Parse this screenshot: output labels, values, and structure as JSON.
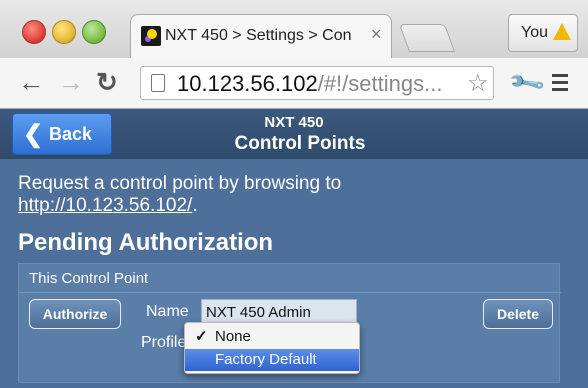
{
  "browser": {
    "tab_title": "NXT 450 > Settings > Con",
    "tab_close": "×",
    "profile_label": "You",
    "url_host": "10.123.56.102",
    "url_path": "/#!/settings..."
  },
  "header": {
    "back_label": "Back",
    "subtitle": "NXT 450",
    "title": "Control Points"
  },
  "content": {
    "request_text": "Request a control point by browsing to",
    "request_link": "http://10.123.56.102/",
    "request_suffix": ".",
    "pending_heading": "Pending Authorization",
    "panel_title": "This Control Point",
    "authorize_label": "Authorize",
    "delete_label": "Delete",
    "name_label": "Name",
    "name_value": "NXT 450 Admin",
    "profile_label": "Profile",
    "profile_options": [
      {
        "label": "None",
        "checked": true
      },
      {
        "label": "Factory Default",
        "highlighted": true
      }
    ]
  },
  "icons": {
    "check": "✓",
    "back_chevron": "❮"
  }
}
